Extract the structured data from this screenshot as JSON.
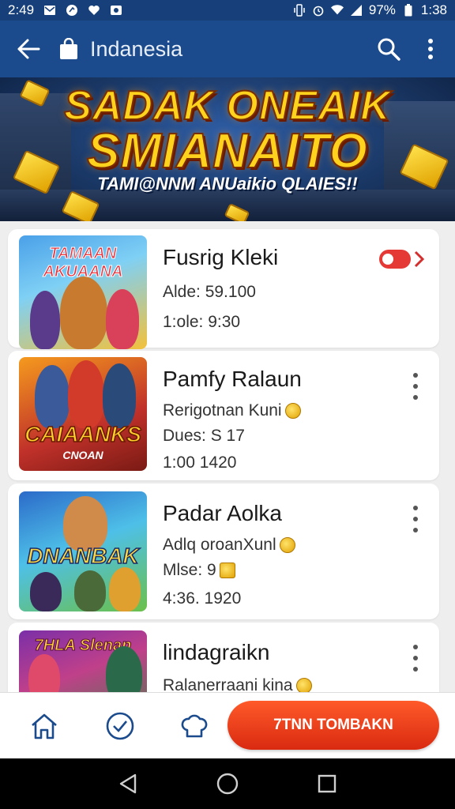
{
  "status_bar": {
    "time_left": "2:49",
    "battery": "97%",
    "time_right": "1:38"
  },
  "app_bar": {
    "title": "Indanesia"
  },
  "banner": {
    "line1": "SADAK ONEAIK",
    "line2": "SMIANAITO",
    "line3": "TAMI@NNM ANUaikio QLAIES!!"
  },
  "list": {
    "items": [
      {
        "thumb_title": "TAMAAN AKUAANA",
        "name": "Fusrig Kleki",
        "line1": "Alde: 59.100",
        "line2": "1:ole: 9:30",
        "colors": {
          "bg1": "#4aa0e8",
          "bg2": "#f3c13a",
          "title": "#e6303a"
        }
      },
      {
        "thumb_title": "CAIAANKS",
        "thumb_sub": "CNOAN",
        "name": "Pamfy Ralaun",
        "line1": "Rerigotnan Kuni",
        "line2": "Dues: S 17",
        "line3": "1:00  1420",
        "colors": {
          "bg1": "#c0312a",
          "bg2": "#f59a1e",
          "title": "#ffcf2a"
        }
      },
      {
        "thumb_title": "DNANBAK",
        "name": "Padar Aolka",
        "line1": "Adlq oroanXunl",
        "line2": "Mlse: 9",
        "line3": "4:36. 1920",
        "colors": {
          "bg1": "#2b6ac9",
          "bg2": "#6bc04a",
          "title": "#ffd83a"
        }
      },
      {
        "thumb_title": "7HLA Slenan",
        "name": "lindagraikn",
        "line1": "Ralanerraani kina",
        "colors": {
          "bg1": "#7b2fa8",
          "bg2": "#2e8a3c",
          "title": "#ffd23a"
        }
      }
    ]
  },
  "bottom_bar": {
    "cta_label": "7TNN TOMBAKN"
  }
}
